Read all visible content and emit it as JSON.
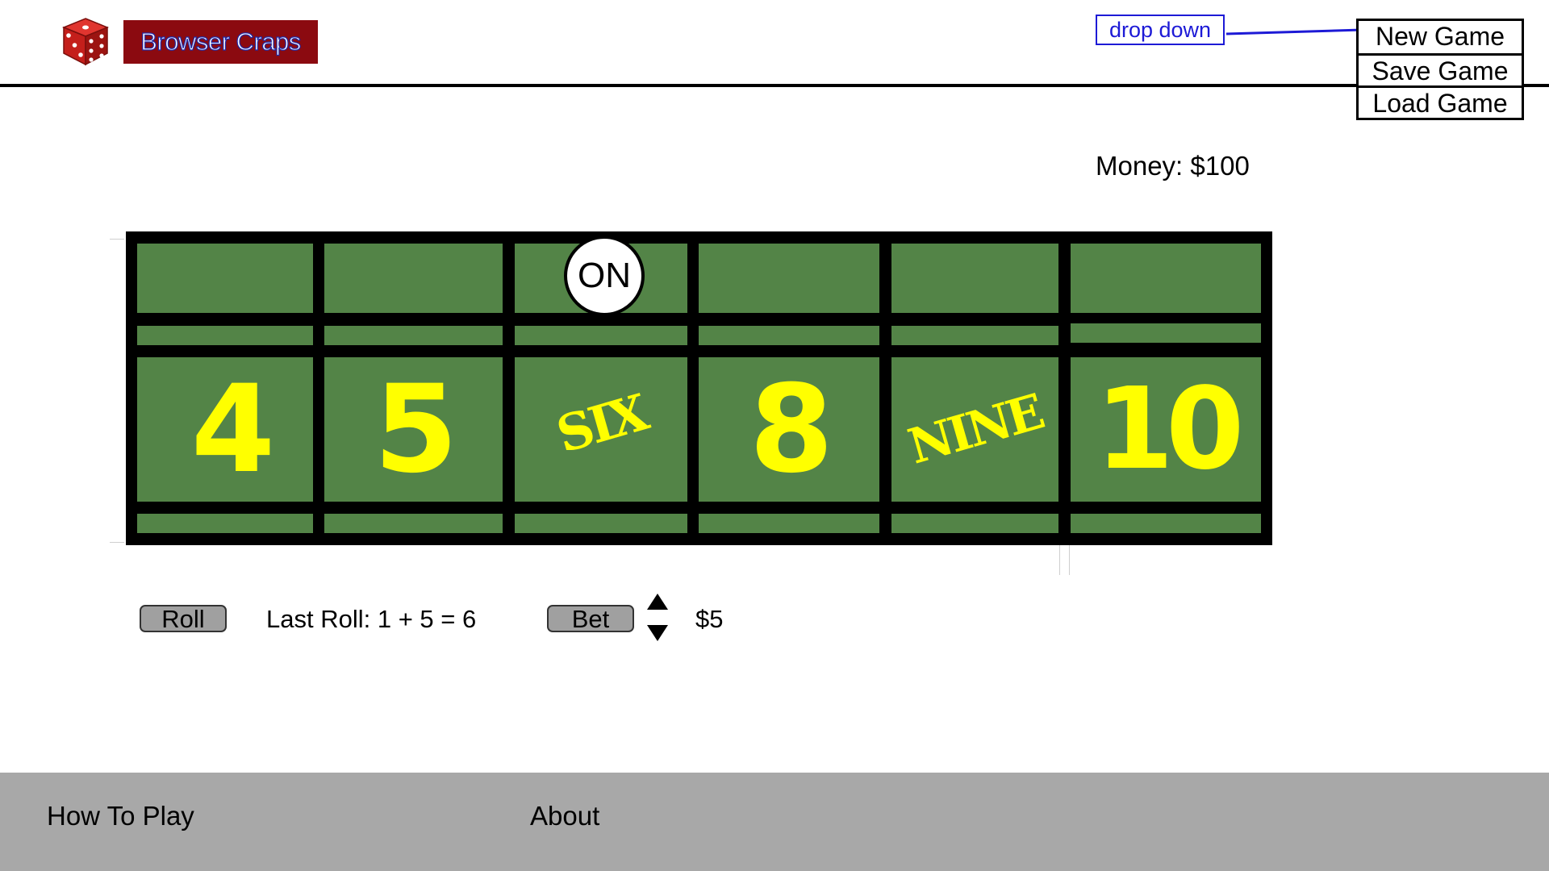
{
  "app": {
    "title": "Browser Craps",
    "icon": "dice-icon"
  },
  "annotation": {
    "label": "drop down",
    "color": "#1d1ad6"
  },
  "menu": {
    "items": [
      "New Game",
      "Save Game",
      "Load Game"
    ]
  },
  "status": {
    "money": "Money: $100"
  },
  "board": {
    "numbers": [
      "4",
      "5",
      "SIX",
      "8",
      "NINE",
      "10"
    ],
    "puck": "ON",
    "colors": {
      "felt": "#538447",
      "numbers": "#ffff00",
      "frame": "#000000"
    }
  },
  "controls": {
    "roll_label": "Roll",
    "last_roll": "Last Roll: 1 + 5 = 6",
    "bet_label": "Bet",
    "bet_up_icon": "up-arrow-icon",
    "bet_down_icon": "down-arrow-icon",
    "bet_amount": "$5"
  },
  "footer": {
    "links": [
      "How To Play",
      "About"
    ]
  },
  "colors": {
    "brand_bg": "#8b0a10",
    "footer_bg": "#a8a8a8",
    "button_bg": "#a0a0a0"
  }
}
